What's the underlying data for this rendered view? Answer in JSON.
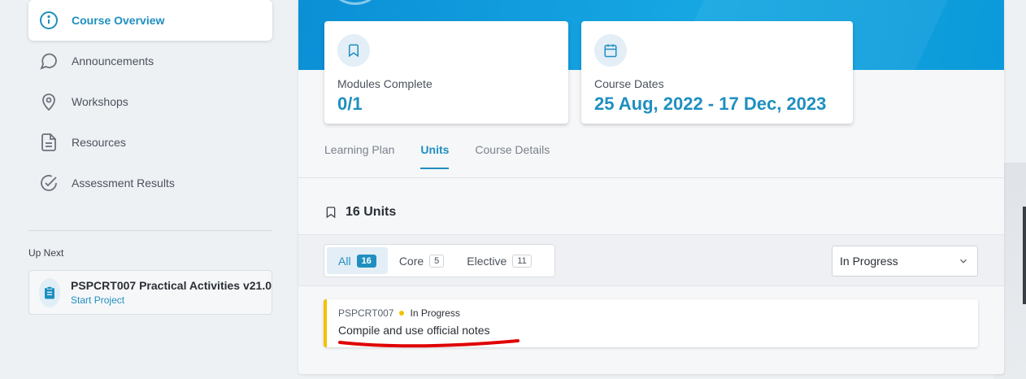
{
  "sidebar": {
    "items": [
      {
        "label": "Course Overview",
        "icon": "info-icon",
        "active": true
      },
      {
        "label": "Announcements",
        "icon": "chat-bubble-icon",
        "active": false
      },
      {
        "label": "Workshops",
        "icon": "map-pin-icon",
        "active": false
      },
      {
        "label": "Resources",
        "icon": "document-icon",
        "active": false
      },
      {
        "label": "Assessment Results",
        "icon": "check-circle-icon",
        "active": false
      }
    ],
    "up_next": {
      "label": "Up Next",
      "title": "PSPCRT007 Practical Activities v21.0",
      "link": "Start Project",
      "icon": "clipboard-icon"
    }
  },
  "stats": {
    "modules": {
      "label": "Modules Complete",
      "value": "0/1",
      "icon": "bookmark-icon"
    },
    "dates": {
      "label": "Course Dates",
      "value": "25 Aug, 2022 - 17 Dec, 2023",
      "icon": "calendar-icon"
    }
  },
  "tabs": [
    {
      "label": "Learning Plan",
      "active": false
    },
    {
      "label": "Units",
      "active": true
    },
    {
      "label": "Course Details",
      "active": false
    }
  ],
  "units": {
    "header": "16 Units",
    "filters": [
      {
        "label": "All",
        "count": "16",
        "active": true
      },
      {
        "label": "Core",
        "count": "5",
        "active": false
      },
      {
        "label": "Elective",
        "count": "11",
        "active": false
      }
    ],
    "status_select": {
      "value": "In Progress"
    },
    "list": [
      {
        "code": "PSPCRT007",
        "status": "In Progress",
        "title": "Compile and use official notes"
      }
    ]
  },
  "colors": {
    "accent": "#1f8fc0",
    "banner": "#0b8fd6",
    "in_progress": "#f2c200",
    "annotation": "#e00000"
  }
}
